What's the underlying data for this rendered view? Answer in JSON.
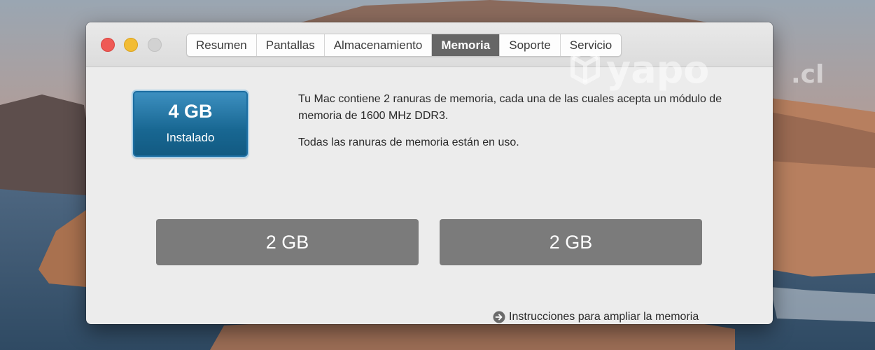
{
  "watermark": "yapo.cl",
  "tabs": [
    {
      "label": "Resumen",
      "active": false
    },
    {
      "label": "Pantallas",
      "active": false
    },
    {
      "label": "Almacenamiento",
      "active": false
    },
    {
      "label": "Memoria",
      "active": true
    },
    {
      "label": "Soporte",
      "active": false
    },
    {
      "label": "Servicio",
      "active": false
    }
  ],
  "memory": {
    "installed_amount": "4 GB",
    "installed_label": "Instalado",
    "description": "Tu Mac contiene 2 ranuras de memoria, cada una de las cuales acepta un módulo de memoria de 1600 MHz DDR3.",
    "status": "Todas las ranuras de memoria están en uso.",
    "slots": [
      "2 GB",
      "2 GB"
    ],
    "upgrade_link": "Instrucciones para ampliar la memoria"
  },
  "colors": {
    "close": "#ef5a55",
    "minimize": "#f2bc34",
    "zoom": "#d2d2d2",
    "active_tab": "#666666",
    "installed_badge": "#186792",
    "slot": "#7b7b7b"
  },
  "icons": {
    "upgrade_link": "arrow-right-circle-icon"
  }
}
